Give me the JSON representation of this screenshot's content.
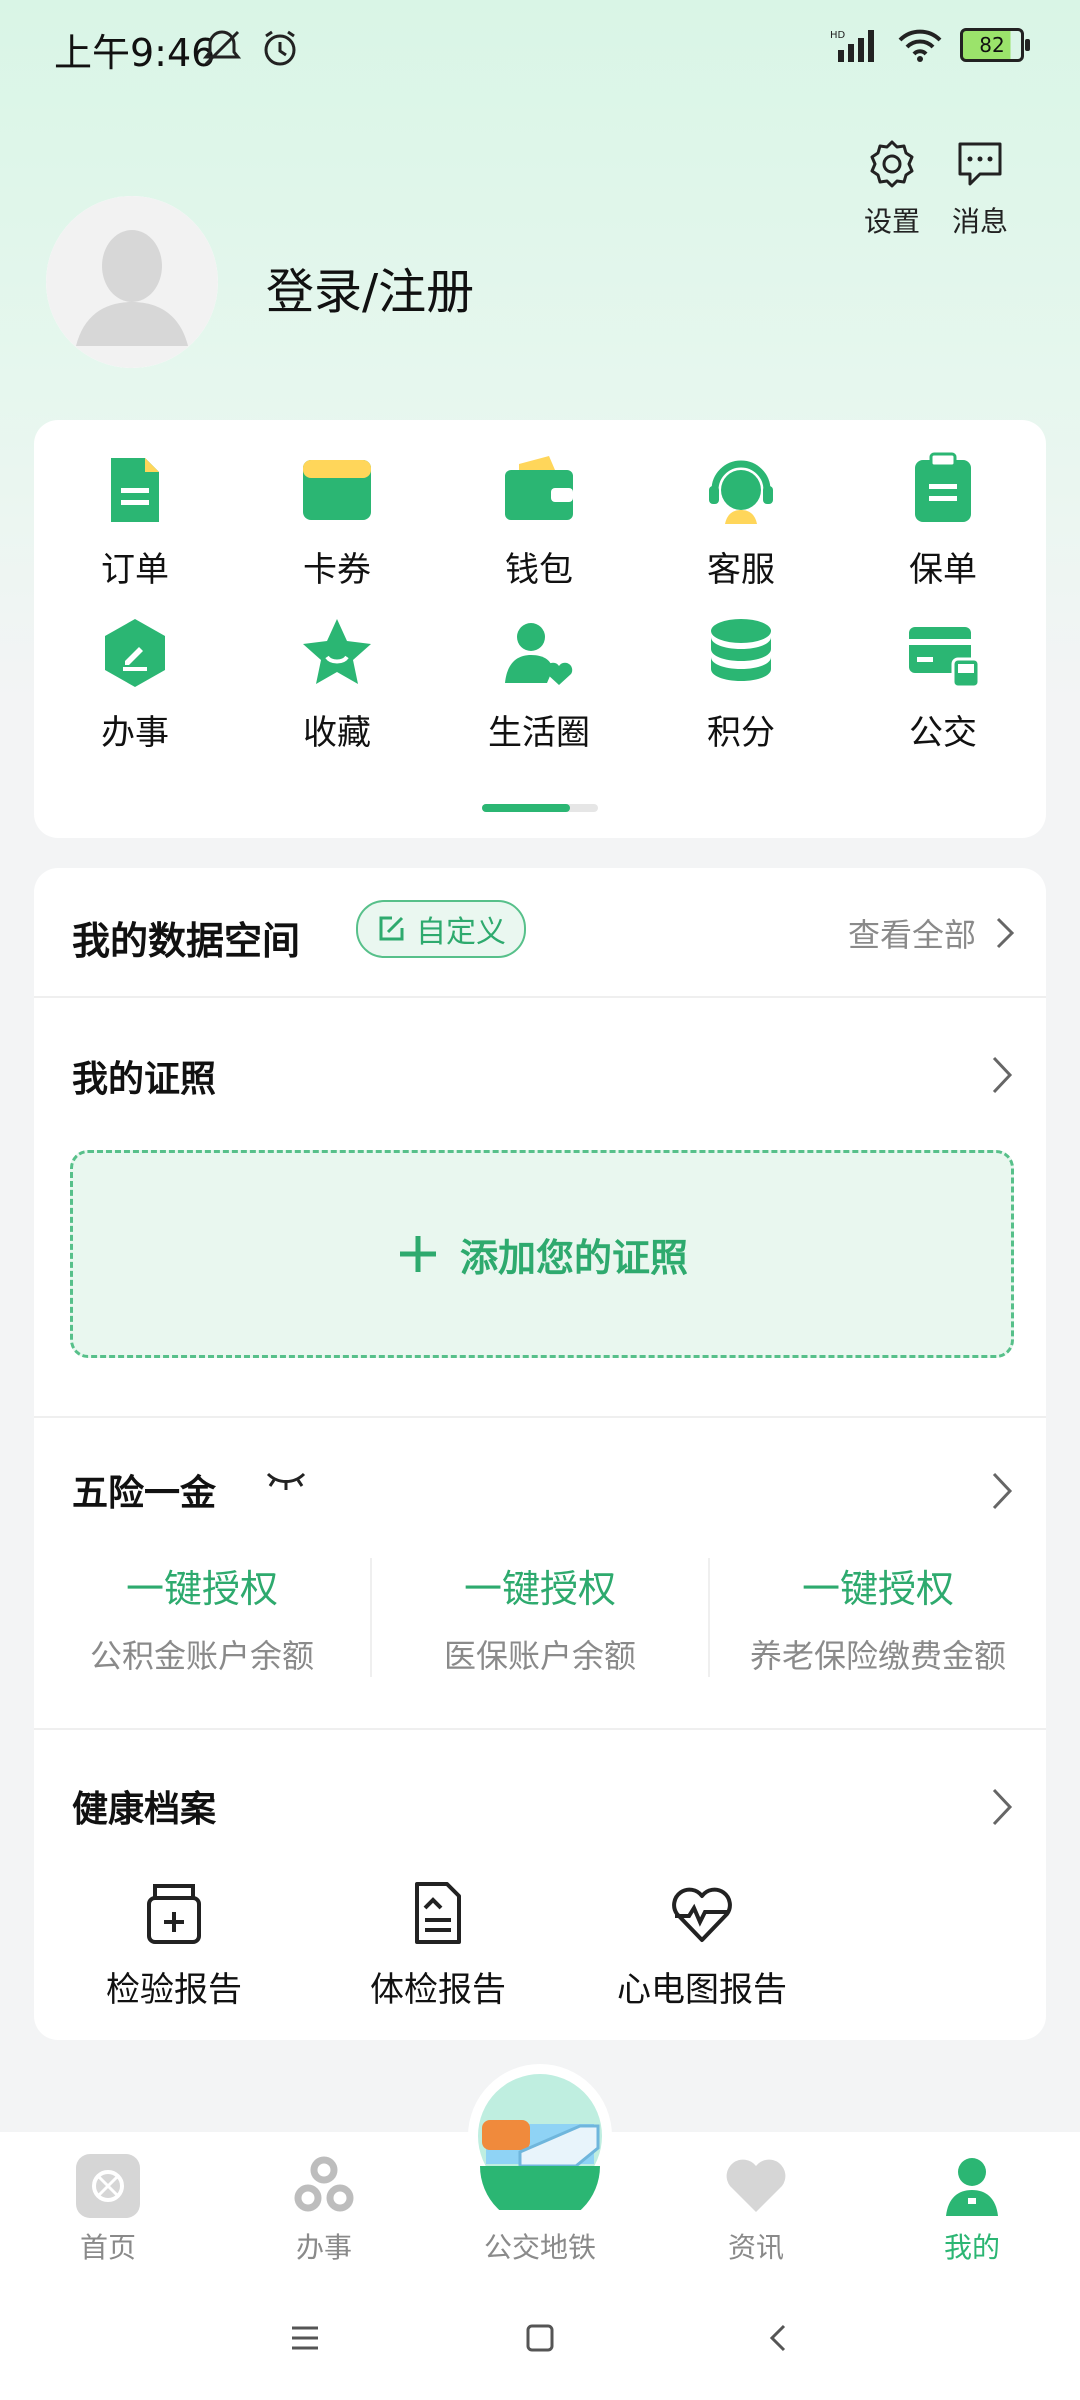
{
  "status": {
    "time": "上午9:46",
    "battery": "82"
  },
  "header": {
    "settings_label": "设置",
    "messages_label": "消息",
    "login_label": "登录/注册"
  },
  "grid": {
    "items": [
      {
        "label": "订单",
        "icon": "order-icon"
      },
      {
        "label": "卡券",
        "icon": "coupon-icon"
      },
      {
        "label": "钱包",
        "icon": "wallet-icon"
      },
      {
        "label": "客服",
        "icon": "customer-service-icon"
      },
      {
        "label": "保单",
        "icon": "policy-icon"
      },
      {
        "label": "办事",
        "icon": "affairs-icon"
      },
      {
        "label": "收藏",
        "icon": "favorite-star-icon"
      },
      {
        "label": "生活圈",
        "icon": "life-circle-icon"
      },
      {
        "label": "积分",
        "icon": "points-icon"
      },
      {
        "label": "公交",
        "icon": "bus-card-icon"
      }
    ]
  },
  "data_space": {
    "title": "我的数据空间",
    "custom_label": "自定义",
    "view_all": "查看全部",
    "licenses_title": "我的证照",
    "add_license": "添加您的证照",
    "insurance_title": "五险一金",
    "insurance": [
      {
        "action": "一键授权",
        "desc": "公积金账户余额"
      },
      {
        "action": "一键授权",
        "desc": "医保账户余额"
      },
      {
        "action": "一键授权",
        "desc": "养老保险缴费金额"
      }
    ],
    "health_title": "健康档案",
    "health_items": [
      {
        "label": "检验报告"
      },
      {
        "label": "体检报告"
      },
      {
        "label": "心电图报告"
      }
    ]
  },
  "nav": {
    "items": [
      {
        "label": "首页"
      },
      {
        "label": "办事"
      },
      {
        "label": "公交地铁"
      },
      {
        "label": "资讯"
      },
      {
        "label": "我的"
      }
    ]
  },
  "colors": {
    "accent": "#2bb673",
    "text": "#111111",
    "muted": "#8a8a8a"
  }
}
